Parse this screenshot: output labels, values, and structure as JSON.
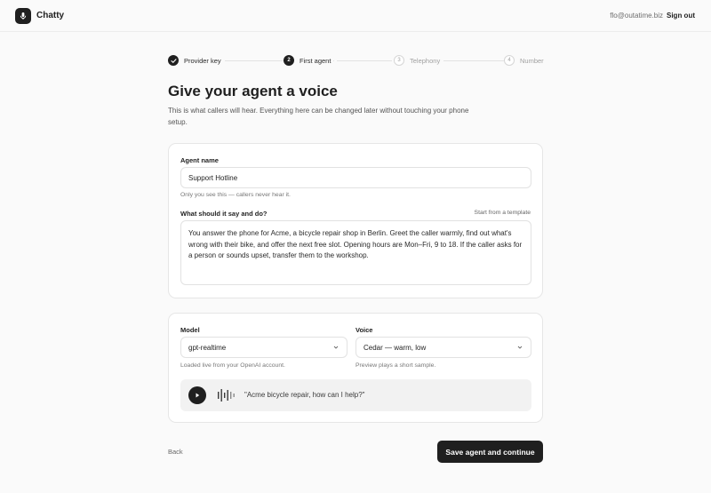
{
  "app": {
    "name": "Chatty"
  },
  "header": {
    "user_email": "flo@outatime.biz",
    "sign_out_label": "Sign out"
  },
  "stepper": {
    "steps": [
      {
        "label": "Provider key",
        "number": "",
        "state": "done"
      },
      {
        "label": "First agent",
        "number": "2",
        "state": "active"
      },
      {
        "label": "Telephony",
        "number": "3",
        "state": "todo"
      },
      {
        "label": "Number",
        "number": "4",
        "state": "todo"
      }
    ]
  },
  "page": {
    "title": "Give your agent a voice",
    "subtitle": "This is what callers will hear. Everything here can be changed later without touching your phone setup."
  },
  "agent_form": {
    "name_label": "Agent name",
    "name_value": "Support Hotline",
    "name_helper": "Only you see this — callers never hear it.",
    "prompt_label": "What should it say and do?",
    "template_link": "Start from a template",
    "prompt_value": "You answer the phone for Acme, a bicycle repair shop in Berlin. Greet the caller warmly, find out what's wrong with their bike, and offer the next free slot. Opening hours are Mon–Fri, 9 to 18. If the caller asks for a person or sounds upset, transfer them to the workshop."
  },
  "voice_form": {
    "model_label": "Model",
    "model_value": "gpt-realtime",
    "model_helper": "Loaded live from your OpenAI account.",
    "voice_label": "Voice",
    "voice_value": "Cedar — warm, low",
    "voice_helper": "Preview plays a short sample.",
    "preview_quote": "\"Acme bicycle repair, how can I help?\""
  },
  "footer": {
    "back_label": "Back",
    "primary_label": "Save agent and continue"
  },
  "icons": {
    "logo": "microphone-icon",
    "step_done": "check-icon",
    "select": "chevron-down-icon",
    "play": "play-icon",
    "waveform": "waveform-icon"
  },
  "colors": {
    "primary": "#1f1f1f",
    "background": "#fafafa",
    "card": "#ffffff",
    "muted": "#777777"
  }
}
